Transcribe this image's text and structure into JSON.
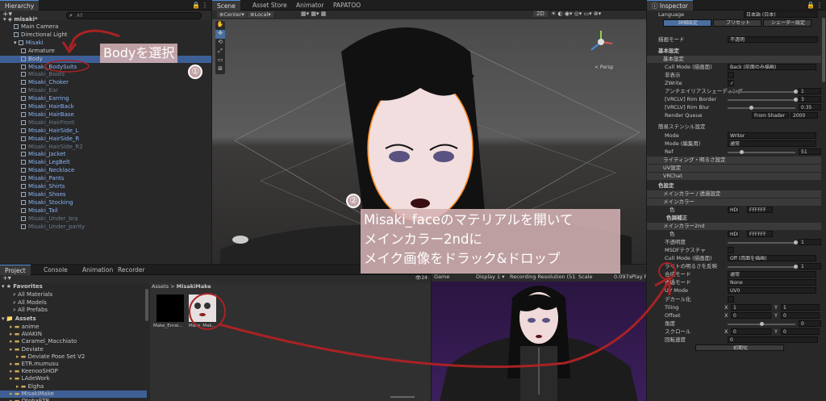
{
  "hierarchy": {
    "tab": "Hierarchy",
    "search_placeholder": "All",
    "scene": "misaki*",
    "items": [
      {
        "label": "Main Camera",
        "indent": 1,
        "style": "normal"
      },
      {
        "label": "Directional Light",
        "indent": 1,
        "style": "normal"
      },
      {
        "label": "Misaki",
        "indent": 1,
        "style": "hi"
      },
      {
        "label": "Armature",
        "indent": 2,
        "style": "normal"
      },
      {
        "label": "Body",
        "indent": 2,
        "style": "sel"
      },
      {
        "label": "Misaki_BodySuits",
        "indent": 2,
        "style": "hi"
      },
      {
        "label": "Misaki_Boots",
        "indent": 2,
        "style": "dim"
      },
      {
        "label": "Misaki_Choker",
        "indent": 2,
        "style": "hi"
      },
      {
        "label": "Misaki_Ear",
        "indent": 2,
        "style": "dim"
      },
      {
        "label": "Misaki_Earring",
        "indent": 2,
        "style": "hi"
      },
      {
        "label": "Misaki_HairBack",
        "indent": 2,
        "style": "hi"
      },
      {
        "label": "Misaki_HairBase",
        "indent": 2,
        "style": "hi"
      },
      {
        "label": "Misaki_HairFront",
        "indent": 2,
        "style": "dim"
      },
      {
        "label": "Misaki_HairSide_L",
        "indent": 2,
        "style": "hi"
      },
      {
        "label": "Misaki_HairSide_R",
        "indent": 2,
        "style": "hi"
      },
      {
        "label": "Misaki_HairSide_R2",
        "indent": 2,
        "style": "dim"
      },
      {
        "label": "Misaki_Jacket",
        "indent": 2,
        "style": "hi"
      },
      {
        "label": "Misaki_LegBelt",
        "indent": 2,
        "style": "hi"
      },
      {
        "label": "Misaki_Necklace",
        "indent": 2,
        "style": "hi"
      },
      {
        "label": "Misaki_Pants",
        "indent": 2,
        "style": "hi"
      },
      {
        "label": "Misaki_Shirts",
        "indent": 2,
        "style": "hi"
      },
      {
        "label": "Misaki_Shoes",
        "indent": 2,
        "style": "hi"
      },
      {
        "label": "Misaki_Stocking",
        "indent": 2,
        "style": "hi"
      },
      {
        "label": "Misaki_Tail",
        "indent": 2,
        "style": "hi"
      },
      {
        "label": "Misaki_Under_bra",
        "indent": 2,
        "style": "dim"
      },
      {
        "label": "Misaki_Under_panty",
        "indent": 2,
        "style": "dim"
      }
    ]
  },
  "scene": {
    "tabs": [
      "Scene",
      "Asset Store",
      "Animator",
      "PAPATOO"
    ],
    "pivot": "Center",
    "space": "Local",
    "mode_2d": "2D",
    "persp": "< Persp"
  },
  "annotations": {
    "step1_text": "Bodyを選択",
    "step1_num": "①",
    "step2_num": "②",
    "step2_line1": "Misaki_faceのマテリアルを開いて",
    "step2_line2": "メインカラー2ndに",
    "step2_line3": "メイク画像をドラック&ドロップ"
  },
  "project": {
    "tabs": [
      "Project",
      "Console",
      "Animation",
      "Recorder"
    ],
    "breadcrumb": [
      "Assets",
      "MisakiMake"
    ],
    "count": "24",
    "favorites_label": "Favorites",
    "favorites": [
      "All Materials",
      "All Models",
      "All Prefabs"
    ],
    "assets_label": "Assets",
    "folders": [
      {
        "label": "anime",
        "indent": 1
      },
      {
        "label": "AVAKIN",
        "indent": 1
      },
      {
        "label": "Caramel_Macchiato",
        "indent": 1
      },
      {
        "label": "Deviate",
        "indent": 1
      },
      {
        "label": "Deviate Pose Set V2",
        "indent": 2
      },
      {
        "label": "ETR.mumusu",
        "indent": 1
      },
      {
        "label": "KeenooSHOP",
        "indent": 1
      },
      {
        "label": "LAdeWork",
        "indent": 1
      },
      {
        "label": "Elgha",
        "indent": 2
      },
      {
        "label": "MisakiMake",
        "indent": 1,
        "selected": true
      },
      {
        "label": "OtohaETR",
        "indent": 1
      },
      {
        "label": "PAPATOO",
        "indent": 1
      }
    ],
    "files": [
      "Make_Enrai...",
      "Make_Mak..."
    ]
  },
  "game": {
    "tab": "Game",
    "display": "Display 1",
    "resolution": "Recording Resolution (512...",
    "scale_label": "Scale",
    "scale_value": "0.097x",
    "play": "Play F"
  },
  "inspector": {
    "tab": "Inspector",
    "language_label": "Language",
    "language_value": "日本語 (日本)",
    "buttons": [
      "詳細設定",
      "プリセット",
      "シェーダー設定"
    ],
    "render_mode_label": "描画モード",
    "render_mode_value": "不透明",
    "basic_heading": "基本設定",
    "basic_section": "基本設定",
    "rows": [
      {
        "label": "Cull Mode (描画面)",
        "value": "Back (前面のみ描画)",
        "kind": "dropdown"
      },
      {
        "label": "非表示",
        "value": "",
        "kind": "check"
      },
      {
        "label": "ZWrite",
        "value": "✓",
        "kind": "check"
      },
      {
        "label": "アンチエイリアスシェーディング",
        "value": "1",
        "kind": "slider",
        "fill": 1.0
      },
      {
        "label": "[VRCLV] Rim Border",
        "value": "3",
        "kind": "slider",
        "fill": 1.0
      },
      {
        "label": "[VRCLV] Rim Blur",
        "value": "0.35",
        "kind": "slider",
        "fill": 0.35
      },
      {
        "label": "Render Queue",
        "value": "2000",
        "kind": "queue",
        "queue_mode": "From Shader"
      }
    ],
    "stencil_heading": "簡易ステンシル設定",
    "stencil_rows": [
      {
        "label": "Mode",
        "value": "Writer",
        "kind": "dropdown"
      },
      {
        "label": "Mode (編集用)",
        "value": "通常",
        "kind": "dropdown"
      },
      {
        "label": "Ref",
        "value": "51",
        "kind": "slider",
        "fill": 0.2
      }
    ],
    "collapsed_sections": [
      "ライティング・明るさ設定",
      "UV設定",
      "VRChat"
    ],
    "color_heading": "色設定",
    "main_color_section": "メインカラー / 透過設定",
    "main_color_sub": "メインカラー",
    "main_color_label": "色",
    "hdr": "HDR",
    "main_hex": "FFFFFF",
    "tone_label": "色調補正",
    "second_section": "メインカラー2nd",
    "second_color_label": "色",
    "second_hex": "FFFFFF",
    "second_rows": [
      {
        "label": "不透明度",
        "value": "1",
        "kind": "slider",
        "fill": 1.0
      },
      {
        "label": "MSDFテクスチャ",
        "value": "",
        "kind": "check"
      },
      {
        "label": "Cull Mode (描画面)",
        "value": "Off (両面を描画)",
        "kind": "dropdown"
      },
      {
        "label": "ライトの明るさを反映",
        "value": "1",
        "kind": "slider",
        "fill": 1.0
      },
      {
        "label": "合成モード",
        "value": "通常",
        "kind": "dropdown"
      },
      {
        "label": "透過モード",
        "value": "None",
        "kind": "dropdown"
      },
      {
        "label": "UV Mode",
        "value": "UV0",
        "kind": "dropdown"
      },
      {
        "label": "デカール化",
        "value": "",
        "kind": "check"
      }
    ],
    "tiling_label": "Tiling",
    "tiling_x": "1",
    "tiling_y": "1",
    "offset_label": "Offset",
    "offset_x": "0",
    "offset_y": "0",
    "angle_label": "角度",
    "angle_value": "0",
    "scroll_label": "スクロール",
    "scroll_x": "0",
    "scroll_y": "0",
    "rotate_label": "回転速度",
    "rotate_value": "0",
    "init_button": "初期化"
  }
}
